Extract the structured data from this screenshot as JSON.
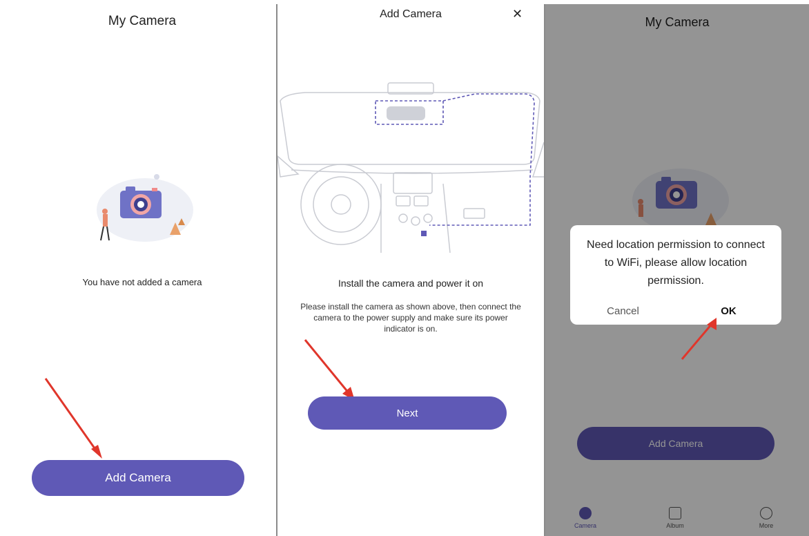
{
  "colors": {
    "accent": "#5f59b6",
    "arrow": "#e0362b",
    "dim_overlay": "rgba(0,0,0,0.42)"
  },
  "screen1": {
    "title": "My Camera",
    "empty_message": "You have not added a camera",
    "add_button": "Add Camera"
  },
  "screen2": {
    "title": "Add Camera",
    "close_icon": "close-icon",
    "heading": "Install the camera and power it on",
    "instructions": "Please install the camera as shown above, then connect the camera to the power supply and make sure its power indicator is on.",
    "next_button": "Next"
  },
  "screen3": {
    "title": "My Camera",
    "dialog": {
      "message": "Need location permission to connect to WiFi, please allow location permission.",
      "cancel": "Cancel",
      "ok": "OK"
    },
    "add_button": "Add Camera",
    "tabs": [
      {
        "label": "Camera",
        "icon": "camera-tab-icon"
      },
      {
        "label": "Album",
        "icon": "album-tab-icon"
      },
      {
        "label": "More",
        "icon": "more-tab-icon"
      }
    ]
  }
}
